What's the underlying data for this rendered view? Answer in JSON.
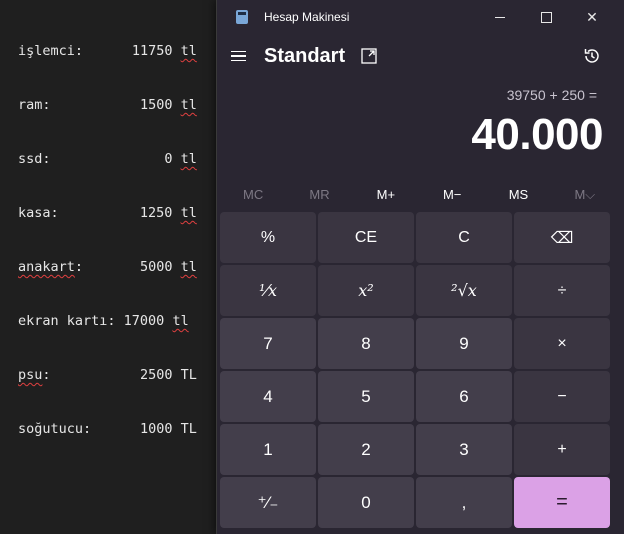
{
  "editor": {
    "lines": [
      {
        "label": "işlemci",
        "value": "11750",
        "unit": "tl"
      },
      {
        "label": "ram",
        "value": "1500",
        "unit": "tl"
      },
      {
        "label": "ssd",
        "value": "0",
        "unit": "tl"
      },
      {
        "label": "kasa",
        "value": "1250",
        "unit": "tl"
      },
      {
        "label": "anakart",
        "value": "5000",
        "unit": "tl"
      },
      {
        "label": "ekran kartı",
        "value": "17000",
        "unit": "tl"
      },
      {
        "label": "psu",
        "value": "2500",
        "unit": "TL"
      },
      {
        "label": "soğutucu",
        "value": "1000",
        "unit": "TL"
      }
    ]
  },
  "calculator": {
    "window_title": "Hesap Makinesi",
    "mode": "Standart",
    "expression": "39750 + 250 =",
    "display": "40.000",
    "memory": [
      "MC",
      "MR",
      "M+",
      "M−",
      "MS",
      "M⌵"
    ],
    "keys": [
      {
        "label": "%",
        "kind": "fn"
      },
      {
        "label": "CE",
        "kind": "fn"
      },
      {
        "label": "C",
        "kind": "fn"
      },
      {
        "label": "⌫",
        "kind": "fn"
      },
      {
        "label": "¹⁄x",
        "kind": "fn"
      },
      {
        "label": "x²",
        "kind": "fn"
      },
      {
        "label": "²√x",
        "kind": "fn"
      },
      {
        "label": "÷",
        "kind": "fn"
      },
      {
        "label": "7",
        "kind": "num"
      },
      {
        "label": "8",
        "kind": "num"
      },
      {
        "label": "9",
        "kind": "num"
      },
      {
        "label": "×",
        "kind": "fn"
      },
      {
        "label": "4",
        "kind": "num"
      },
      {
        "label": "5",
        "kind": "num"
      },
      {
        "label": "6",
        "kind": "num"
      },
      {
        "label": "−",
        "kind": "fn"
      },
      {
        "label": "1",
        "kind": "num"
      },
      {
        "label": "2",
        "kind": "num"
      },
      {
        "label": "3",
        "kind": "num"
      },
      {
        "label": "+",
        "kind": "fn"
      },
      {
        "label": "⁺⁄₋",
        "kind": "num"
      },
      {
        "label": "0",
        "kind": "num"
      },
      {
        "label": ",",
        "kind": "num"
      },
      {
        "label": "=",
        "kind": "equals"
      }
    ],
    "accent_color": "#dba1e6"
  }
}
